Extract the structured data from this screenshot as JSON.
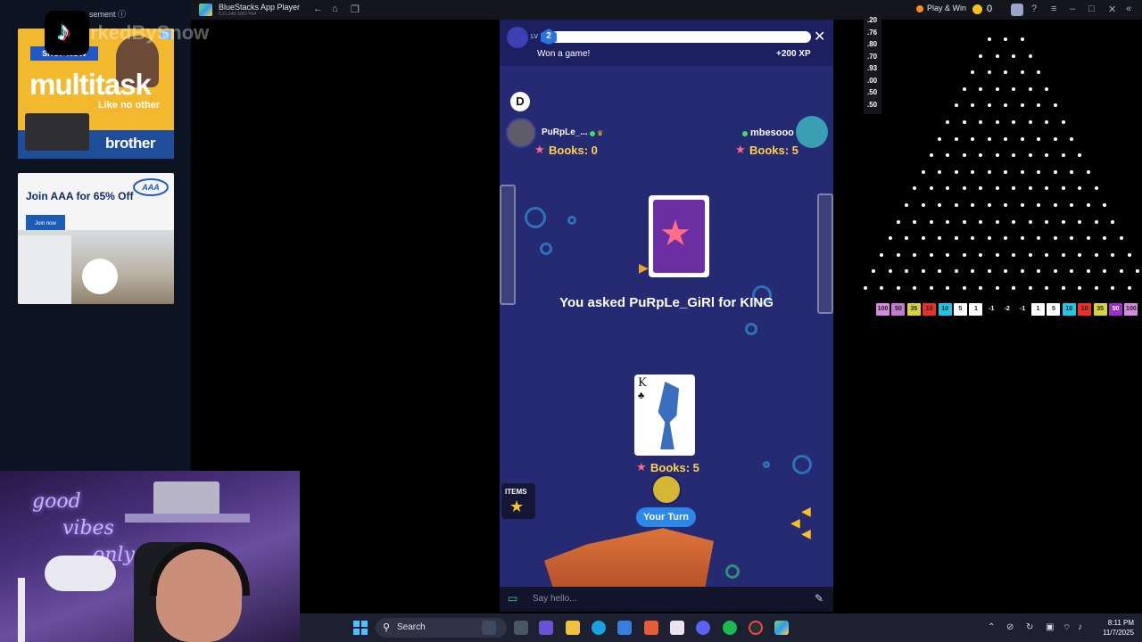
{
  "ads": {
    "header": "sement",
    "watermark": "rkedBySnow",
    "ad1": {
      "shop_now": "SHOP NOW",
      "headline": "multitask",
      "tagline": "Like no other",
      "brand": "brother"
    },
    "ad2": {
      "headline": "Join AAA for 65% Off",
      "logo": "AAA",
      "button": "Join now"
    }
  },
  "titlebar": {
    "app_name": "BlueStacks App Player",
    "version": "5.21.640.1002 P64",
    "play_win": "Play & Win",
    "coins": "0"
  },
  "game": {
    "level_label": "LV",
    "level": "2",
    "won_text": "Won a game!",
    "xp_reward": "+200 XP",
    "dealer_marker": "D",
    "player1": {
      "name": "PuRpLe_...",
      "books": "Books: 0"
    },
    "player2": {
      "name": "mbesooo",
      "books": "Books: 5"
    },
    "message": "You asked PuRpLe_GiRl for KING",
    "card": {
      "rank": "K",
      "suit": "♣"
    },
    "me": {
      "books": "Books: 5",
      "status": "Your Turn"
    },
    "items_label": "ITEMS",
    "chat_placeholder": "Say hello..."
  },
  "plinko": {
    "odds": [
      ".20",
      ".76",
      ".80",
      ".70",
      ".93",
      ".00",
      ".50",
      ".50"
    ],
    "slots": [
      {
        "label": "100",
        "color": "#d58be0"
      },
      {
        "label": "50",
        "color": "#c27bd0"
      },
      {
        "label": "35",
        "color": "#d7d43a"
      },
      {
        "label": "10",
        "color": "#e8302b"
      },
      {
        "label": "10",
        "color": "#22c6e0"
      },
      {
        "label": "5",
        "color": "#ffffff"
      },
      {
        "label": "1",
        "color": "#ffffff"
      },
      {
        "label": "-1",
        "color": "#000000"
      },
      {
        "label": "-2",
        "color": "#000000"
      },
      {
        "label": "-1",
        "color": "#000000"
      },
      {
        "label": "1",
        "color": "#ffffff"
      },
      {
        "label": "5",
        "color": "#ffffff"
      },
      {
        "label": "10",
        "color": "#22c6e0"
      },
      {
        "label": "10",
        "color": "#e8302b"
      },
      {
        "label": "35",
        "color": "#d7d43a"
      },
      {
        "label": "50",
        "color": "#9b2fc8"
      },
      {
        "label": "100",
        "color": "#d58be0"
      }
    ]
  },
  "taskbar": {
    "search_label": "Search",
    "time": "8:11 PM",
    "date": "11/7/2025"
  },
  "colors": {
    "game_bg": "#262a73",
    "accent": "#2a88e8",
    "books": "#ffd24a"
  }
}
